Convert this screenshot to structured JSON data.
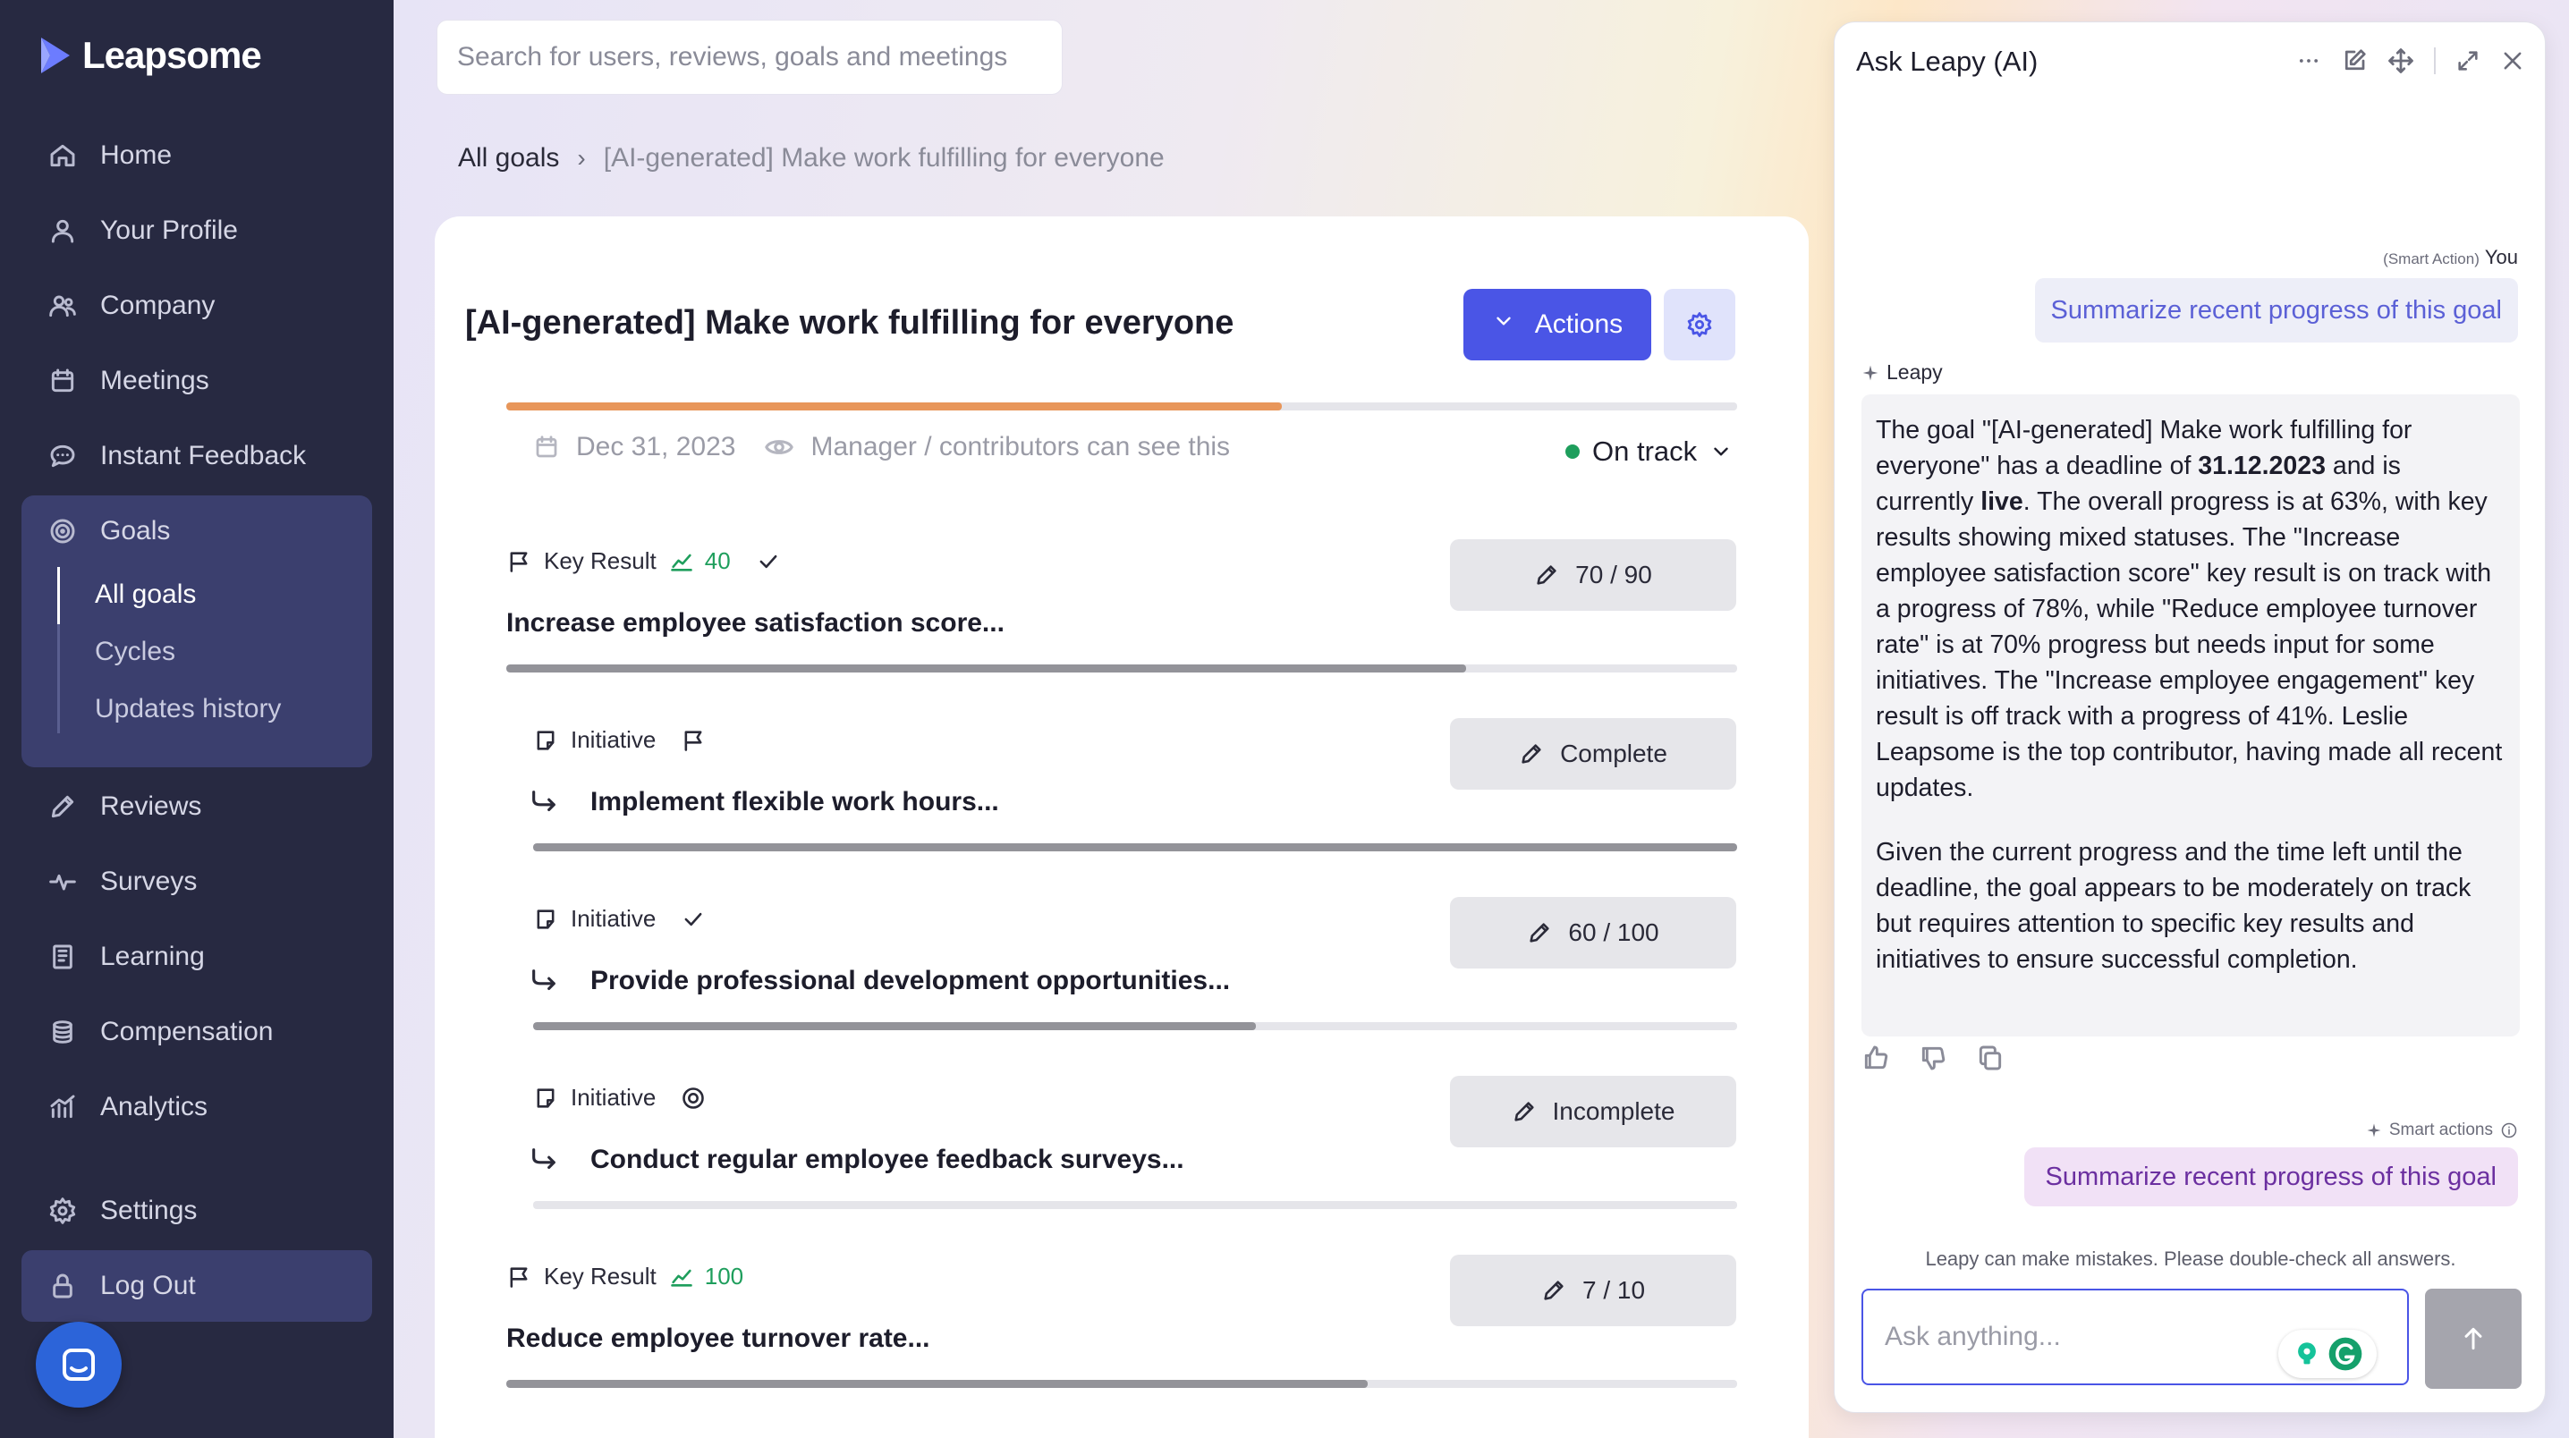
{
  "sidebar": {
    "brand": "Leapsome",
    "nav": {
      "home": "Home",
      "profile": "Your Profile",
      "company": "Company",
      "meetings": "Meetings",
      "instant_feedback": "Instant Feedback",
      "goals": "Goals",
      "reviews": "Reviews",
      "surveys": "Surveys",
      "learning": "Learning",
      "compensation": "Compensation",
      "analytics": "Analytics",
      "settings": "Settings",
      "logout": "Log Out"
    },
    "goals_sub": [
      "All goals",
      "Cycles",
      "Updates history"
    ]
  },
  "search": {
    "placeholder": "Search for users, reviews, goals and meetings"
  },
  "breadcrumb": {
    "root": "All goals",
    "separator": "›",
    "current": "[AI-generated] Make work fulfilling for everyone"
  },
  "goal": {
    "title": "[AI-generated] Make work fulfilling for everyone",
    "actions_label": "Actions",
    "progress": 0.63,
    "progress_color": "#e8965a",
    "due_date": "Dec 31, 2023",
    "visibility": "Manager / contributors can see this",
    "status": "On track",
    "status_color": "#1e9e5c"
  },
  "items": [
    {
      "type": "Key Result",
      "weight": "40",
      "title": "Increase employee satisfaction score...",
      "button": "70 / 90",
      "progress": 0.78,
      "status_icon": "check-icon"
    },
    {
      "type": "Initiative",
      "title": "Implement flexible work hours...",
      "button": "Complete",
      "progress": 1.0,
      "status_icon": "flag-icon"
    },
    {
      "type": "Initiative",
      "title": "Provide professional development opportunities...",
      "button": "60 / 100",
      "progress": 0.6,
      "status_icon": "check-icon"
    },
    {
      "type": "Initiative",
      "title": "Conduct regular employee feedback surveys...",
      "button": "Incomplete",
      "progress": 0.0,
      "status_icon": "target-icon"
    },
    {
      "type": "Key Result",
      "weight": "100",
      "title": "Reduce employee turnover rate...",
      "button": "7 / 10",
      "progress": 0.7,
      "status_icon": ""
    }
  ],
  "ai": {
    "title": "Ask Leapy (AI)",
    "smart_action_tag": "(Smart Action)",
    "you": "You",
    "user_message": "Summarize recent progress of this goal",
    "leapy": "Leapy",
    "answer": {
      "p1_a": "The goal \"[AI-generated] Make work fulfilling for everyone\" has a deadline of ",
      "p1_date": "31.12.2023",
      "p1_b": " and is currently ",
      "p1_live": "live",
      "p1_c": ". The overall progress is at 63%, with key results showing mixed statuses. The \"Increase employee satisfaction score\" key result is on track with a progress of 78%, while \"Reduce employee turnover rate\" is at 70% progress but needs input for some initiatives. The \"Increase employee engagement\" key result is off track with a progress of 41%. Leslie Leapsome is the top contributor, having made all recent updates.",
      "p2": "Given the current progress and the time left until the deadline, the goal appears to be moderately on track but requires attention to specific key results and initiatives to ensure successful completion."
    },
    "smart_actions_label": "Smart actions",
    "smart_action_button": "Summarize recent progress of this goal",
    "disclaimer": "Leapy can make mistakes. Please double-check all answers.",
    "input_placeholder": "Ask anything..."
  }
}
